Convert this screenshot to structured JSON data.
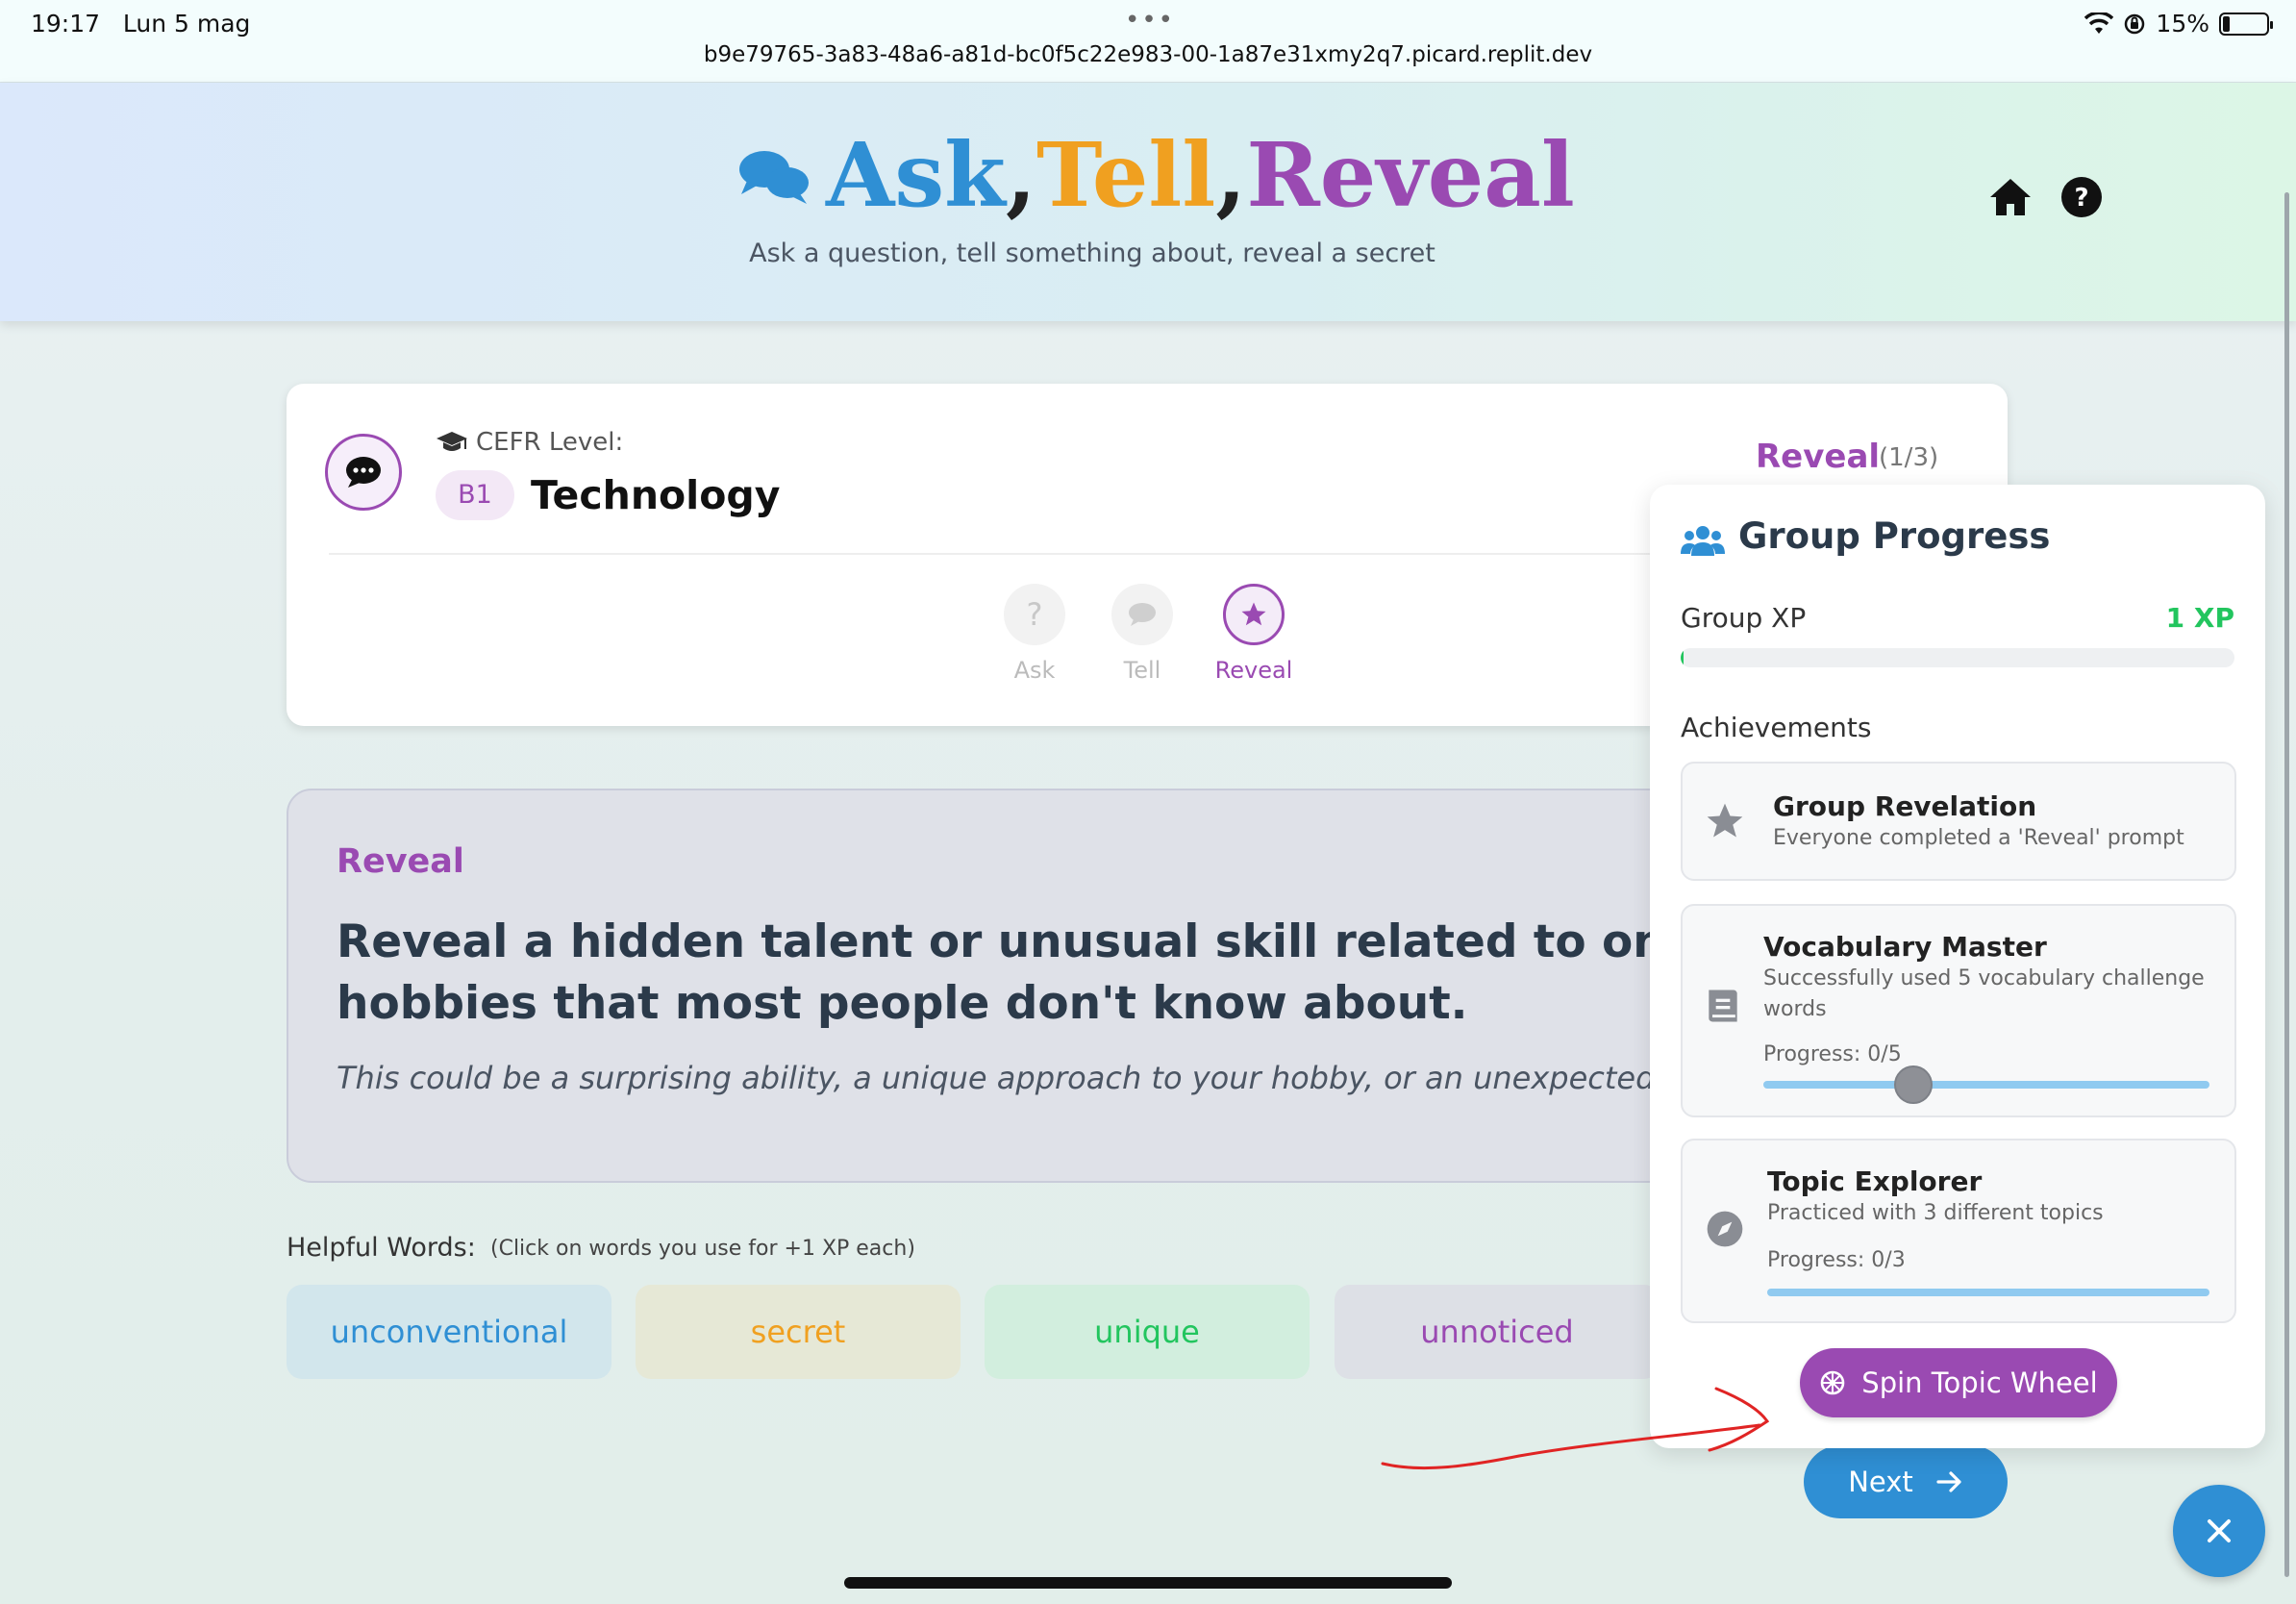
{
  "status_bar": {
    "time": "19:17",
    "date": "Lun 5 mag",
    "dots": "•••",
    "url": "b9e79765-3a83-48a6-a81d-bc0f5c22e983-00-1a87e31xmy2q7.picard.replit.dev",
    "battery": "15%",
    "icons": [
      "wifi-icon",
      "orientation-lock-icon",
      "battery-icon"
    ]
  },
  "header": {
    "logo_icon": "chat-bubbles-icon",
    "word_ask": "Ask",
    "word_tell": "Tell",
    "word_reveal": "Reveal",
    "comma": ",",
    "tagline": "Ask a question, tell something about, reveal a secret",
    "icons": [
      "home-icon",
      "help-icon"
    ]
  },
  "topic_card": {
    "topic_icon": "comment-dots-icon",
    "cefr_label": "CEFR Level:",
    "cefr_icon": "graduation-cap-icon",
    "level": "B1",
    "topic": "Technology",
    "stage": "Reveal",
    "stage_count": "(1/3)",
    "steps": [
      {
        "label": "Ask",
        "icon": "question-icon",
        "active": false
      },
      {
        "label": "Tell",
        "icon": "speech-bubble-icon",
        "active": false
      },
      {
        "label": "Reveal",
        "icon": "star-icon",
        "active": true
      }
    ]
  },
  "prompt": {
    "label": "Reveal",
    "main": "Reveal a hidden talent or unusual skill related to one of your hobbies that most people don't know about.",
    "hint": "This could be a surprising ability, a unique approach to your hobby, or an unexpected area of expertise."
  },
  "helpful_words": {
    "title": "Helpful Words:",
    "hint": "(Click on words you use for +1 XP each)",
    "words": [
      {
        "text": "unconventional",
        "color": "#2f8fd4",
        "bg": "#d2e6ec"
      },
      {
        "text": "secret",
        "color": "#f0a020",
        "bg": "#e6e8d6"
      },
      {
        "text": "unique",
        "color": "#22c55e",
        "bg": "#d2eede"
      },
      {
        "text": "unnoticed",
        "color": "#9a4ab2",
        "bg": "#dde0e6"
      }
    ]
  },
  "next_button": {
    "label": "Next",
    "icon": "arrow-right-icon"
  },
  "group_progress": {
    "title": "Group Progress",
    "title_icon": "users-icon",
    "xp_label": "Group XP",
    "xp_value": "1 XP",
    "xp_fraction": 0.005,
    "achievements_title": "Achievements",
    "achievements": [
      {
        "name": "Group Revelation",
        "desc": "Everyone completed a 'Reveal' prompt",
        "icon": "star-icon"
      },
      {
        "name": "Vocabulary Master",
        "desc": "Successfully used 5 vocabulary challenge words",
        "icon": "book-icon",
        "progress": "Progress: 0/5",
        "fraction": 0
      },
      {
        "name": "Topic Explorer",
        "desc": "Practiced with 3 different topics",
        "icon": "compass-icon",
        "progress": "Progress: 0/3",
        "fraction": 0
      }
    ],
    "spin_button": {
      "label": "Spin Topic Wheel",
      "icon": "wheel-icon"
    }
  },
  "fab": {
    "icon": "close-icon"
  },
  "colors": {
    "blue": "#2f8fd4",
    "orange": "#f0a020",
    "purple": "#9a4ab2",
    "green": "#22c55e",
    "annotation_red": "#e02424"
  }
}
